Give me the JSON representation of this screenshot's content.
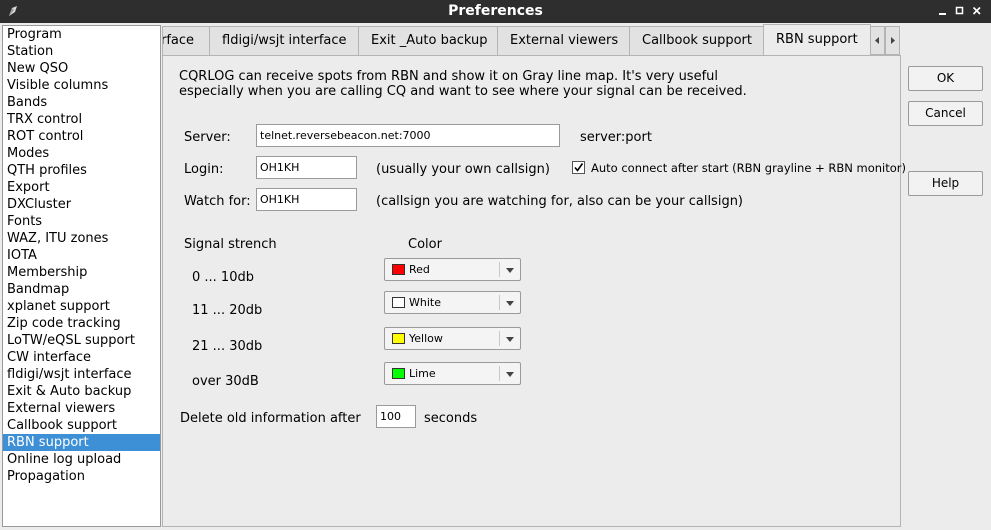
{
  "window": {
    "title": "Preferences"
  },
  "sidebar": {
    "items": [
      "Program",
      "Station",
      "New QSO",
      "Visible columns",
      "Bands",
      "TRX control",
      "ROT control",
      "Modes",
      "QTH profiles",
      "Export",
      "DXCluster",
      "Fonts",
      "WAZ, ITU zones",
      "IOTA",
      "Membership",
      "Bandmap",
      "xplanet support",
      "Zip code tracking",
      "LoTW/eQSL support",
      "CW interface",
      "fldigi/wsjt interface",
      "Exit & Auto backup",
      "External viewers",
      "Callbook support",
      "RBN support",
      "Online log upload",
      "Propagation"
    ],
    "selected": "RBN support"
  },
  "tabs": [
    {
      "label": "rface"
    },
    {
      "label": "fldigi/wsjt interface"
    },
    {
      "label": "Exit _Auto backup"
    },
    {
      "label": "External viewers"
    },
    {
      "label": "Callbook support"
    },
    {
      "label": "RBN support"
    }
  ],
  "rbn": {
    "description": "CQRLOG can receive spots from RBN and show it on Gray line map. It's very useful especially when you are calling CQ and want to see where your signal can be received.",
    "server_label": "Server:",
    "server_value": "telnet.reversebeacon.net:7000",
    "server_hint": "server:port",
    "login_label": "Login:",
    "login_value": "OH1KH",
    "login_hint": "(usually your own callsign)",
    "auto_connect_label": "Auto connect after start (RBN grayline + RBN monitor)",
    "auto_connect_checked": true,
    "watch_label": "Watch for:",
    "watch_value": "OH1KH",
    "watch_hint": "(callsign you are watching for, also can be your callsign)",
    "signal_header": "Signal strench",
    "color_header": "Color",
    "levels": [
      {
        "label": "0 ... 10db",
        "color_name": "Red",
        "color": "#ff0000"
      },
      {
        "label": "11 ... 20db",
        "color_name": "White",
        "color": "#ffffff"
      },
      {
        "label": "21 ... 30db",
        "color_name": "Yellow",
        "color": "#ffff00"
      },
      {
        "label": "over 30dB",
        "color_name": "Lime",
        "color": "#00ff00"
      }
    ],
    "delete_label": "Delete old information after",
    "delete_value": "100",
    "delete_unit": "seconds"
  },
  "buttons": {
    "ok": "OK",
    "cancel": "Cancel",
    "help": "Help"
  },
  "colors": {
    "titlebar_bg": "#2e2e2e",
    "selection": "#3d8fd6"
  }
}
